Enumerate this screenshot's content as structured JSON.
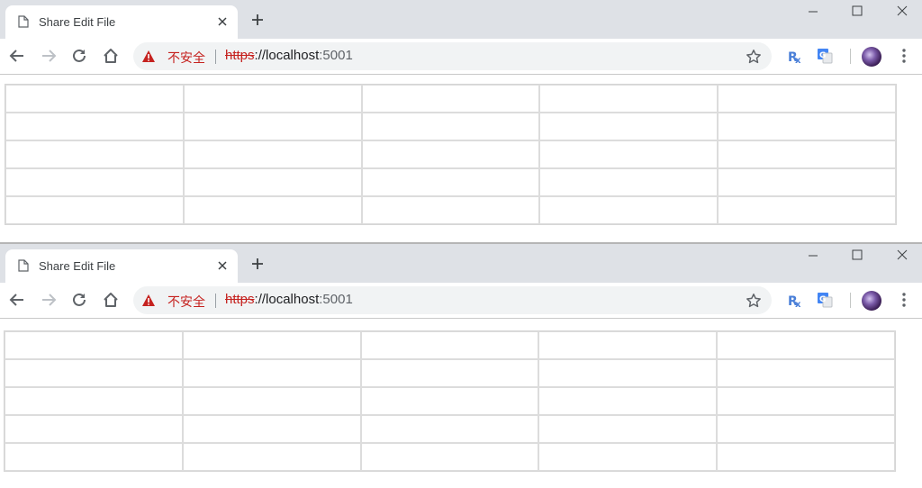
{
  "windows": [
    {
      "tab": {
        "title": "Share Edit File"
      },
      "security": {
        "label": "不安全"
      },
      "url": {
        "scheme": "https",
        "rest": "://localhost",
        "port": ":5001"
      },
      "table": {
        "rows": 5,
        "cols": 5
      }
    },
    {
      "tab": {
        "title": "Share Edit File"
      },
      "security": {
        "label": "不安全"
      },
      "url": {
        "scheme": "https",
        "rest": "://localhost",
        "port": ":5001"
      },
      "table": {
        "rows": 5,
        "cols": 5
      }
    }
  ],
  "colors": {
    "warning": "#c5221f",
    "tabstrip": "#dee1e6",
    "grid_line": "#dcdcdc"
  },
  "icons": [
    "document-icon",
    "close-icon",
    "plus-icon",
    "minimize-icon",
    "maximize-icon",
    "window-close-icon",
    "back-arrow-icon",
    "forward-arrow-icon",
    "reload-icon",
    "home-icon",
    "warning-icon",
    "star-icon",
    "rx-extension-icon",
    "translate-extension-icon",
    "profile-avatar",
    "kebab-menu-icon"
  ]
}
